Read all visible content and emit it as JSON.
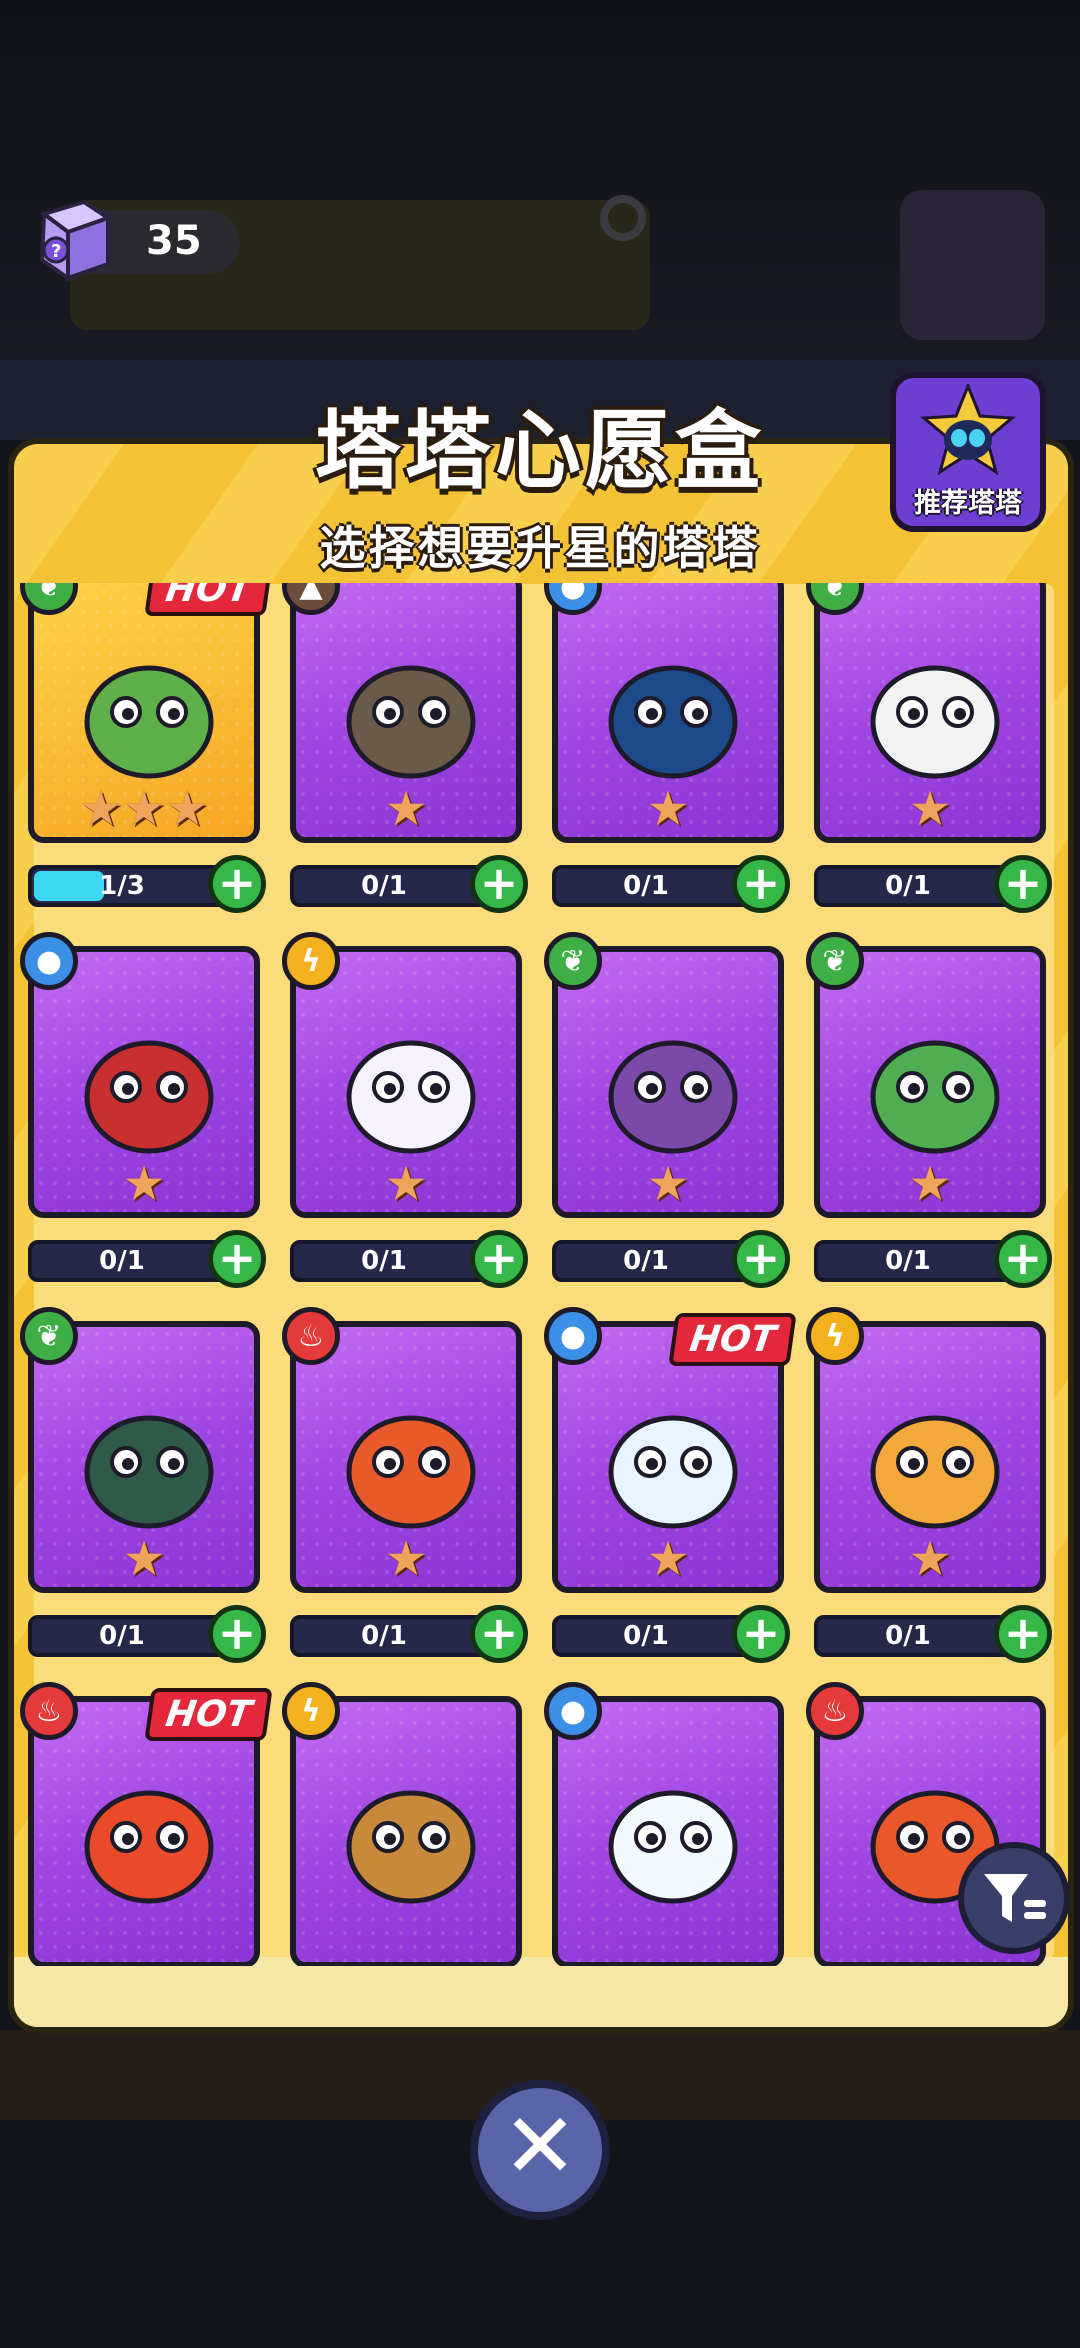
{
  "header": {
    "box_count": "35"
  },
  "panel": {
    "title": "塔塔心愿盒",
    "subtitle": "选择想要升星的塔塔",
    "recommend_label": "推荐塔塔",
    "hot_label": "HOT"
  },
  "cards": [
    {
      "element": "grass",
      "stars": "★★★",
      "progress": "1/3",
      "fill": 0.333,
      "hot": true,
      "gold": true,
      "color": "#5fb04a"
    },
    {
      "element": "earth",
      "stars": "★",
      "progress": "0/1",
      "fill": 0,
      "hot": false,
      "gold": false,
      "color": "#6b5a48"
    },
    {
      "element": "water",
      "stars": "★",
      "progress": "0/1",
      "fill": 0,
      "hot": false,
      "gold": false,
      "color": "#1d4a8a"
    },
    {
      "element": "grass",
      "stars": "★",
      "progress": "0/1",
      "fill": 0,
      "hot": false,
      "gold": false,
      "color": "#f2f2f2"
    },
    {
      "element": "water",
      "stars": "★",
      "progress": "0/1",
      "fill": 0,
      "hot": false,
      "gold": false,
      "color": "#c83030"
    },
    {
      "element": "thunder",
      "stars": "★",
      "progress": "0/1",
      "fill": 0,
      "hot": false,
      "gold": false,
      "color": "#f7f2ff"
    },
    {
      "element": "grass",
      "stars": "★",
      "progress": "0/1",
      "fill": 0,
      "hot": false,
      "gold": false,
      "color": "#7a4aa8"
    },
    {
      "element": "grass",
      "stars": "★",
      "progress": "0/1",
      "fill": 0,
      "hot": false,
      "gold": false,
      "color": "#4fae52"
    },
    {
      "element": "grass",
      "stars": "★",
      "progress": "0/1",
      "fill": 0,
      "hot": false,
      "gold": false,
      "color": "#2f5a48"
    },
    {
      "element": "fire",
      "stars": "★",
      "progress": "0/1",
      "fill": 0,
      "hot": false,
      "gold": false,
      "color": "#e85a2a"
    },
    {
      "element": "water",
      "stars": "★",
      "progress": "0/1",
      "fill": 0,
      "hot": true,
      "gold": false,
      "color": "#e8f4ff"
    },
    {
      "element": "thunder",
      "stars": "★",
      "progress": "0/1",
      "fill": 0,
      "hot": false,
      "gold": false,
      "color": "#f2a83a"
    },
    {
      "element": "fire",
      "stars": "",
      "progress": "",
      "fill": 0,
      "hot": true,
      "gold": false,
      "color": "#e84a2a"
    },
    {
      "element": "thunder",
      "stars": "",
      "progress": "",
      "fill": 0,
      "hot": false,
      "gold": false,
      "color": "#c88a3a"
    },
    {
      "element": "water",
      "stars": "",
      "progress": "",
      "fill": 0,
      "hot": false,
      "gold": false,
      "color": "#f4f8ff"
    },
    {
      "element": "fire",
      "stars": "",
      "progress": "",
      "fill": 0,
      "hot": false,
      "gold": false,
      "color": "#e8582a"
    }
  ],
  "icons": {
    "grass": "leaf-icon",
    "water": "water-drop-icon",
    "thunder": "lightning-icon",
    "fire": "fire-icon",
    "earth": "mountain-icon",
    "plus": "+",
    "close": "✕"
  }
}
